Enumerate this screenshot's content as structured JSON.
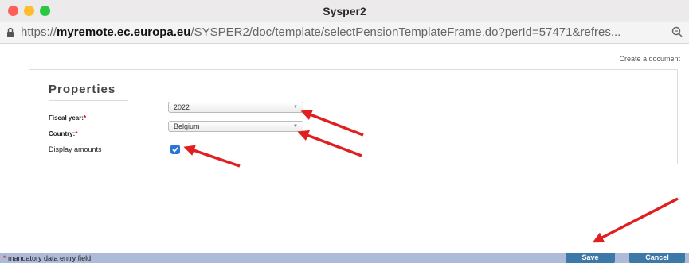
{
  "window": {
    "title": "Sysper2"
  },
  "browser": {
    "url_prefix": "https://",
    "url_domain": "myremote.ec.europa.eu",
    "url_path": "/SYSPER2/doc/template/selectPensionTemplateFrame.do?perId=57471&refres..."
  },
  "page": {
    "create_link": "Create a document",
    "properties": {
      "heading": "Properties",
      "fiscal_year_label": "Fiscal year:",
      "fiscal_year_value": "2022",
      "country_label": "Country:",
      "country_value": "Belgium",
      "required_marker": "*",
      "display_amounts_label": "Display amounts",
      "display_amounts_checked": true
    }
  },
  "footer": {
    "required_marker": "*",
    "note": " mandatory data entry field",
    "save_label": "Save",
    "cancel_label": "Cancel"
  },
  "colors": {
    "accent": "#3c78a8",
    "annotation_arrow": "#e02020",
    "footer_bg": "#adbad8",
    "checkbox": "#2a73d9"
  }
}
